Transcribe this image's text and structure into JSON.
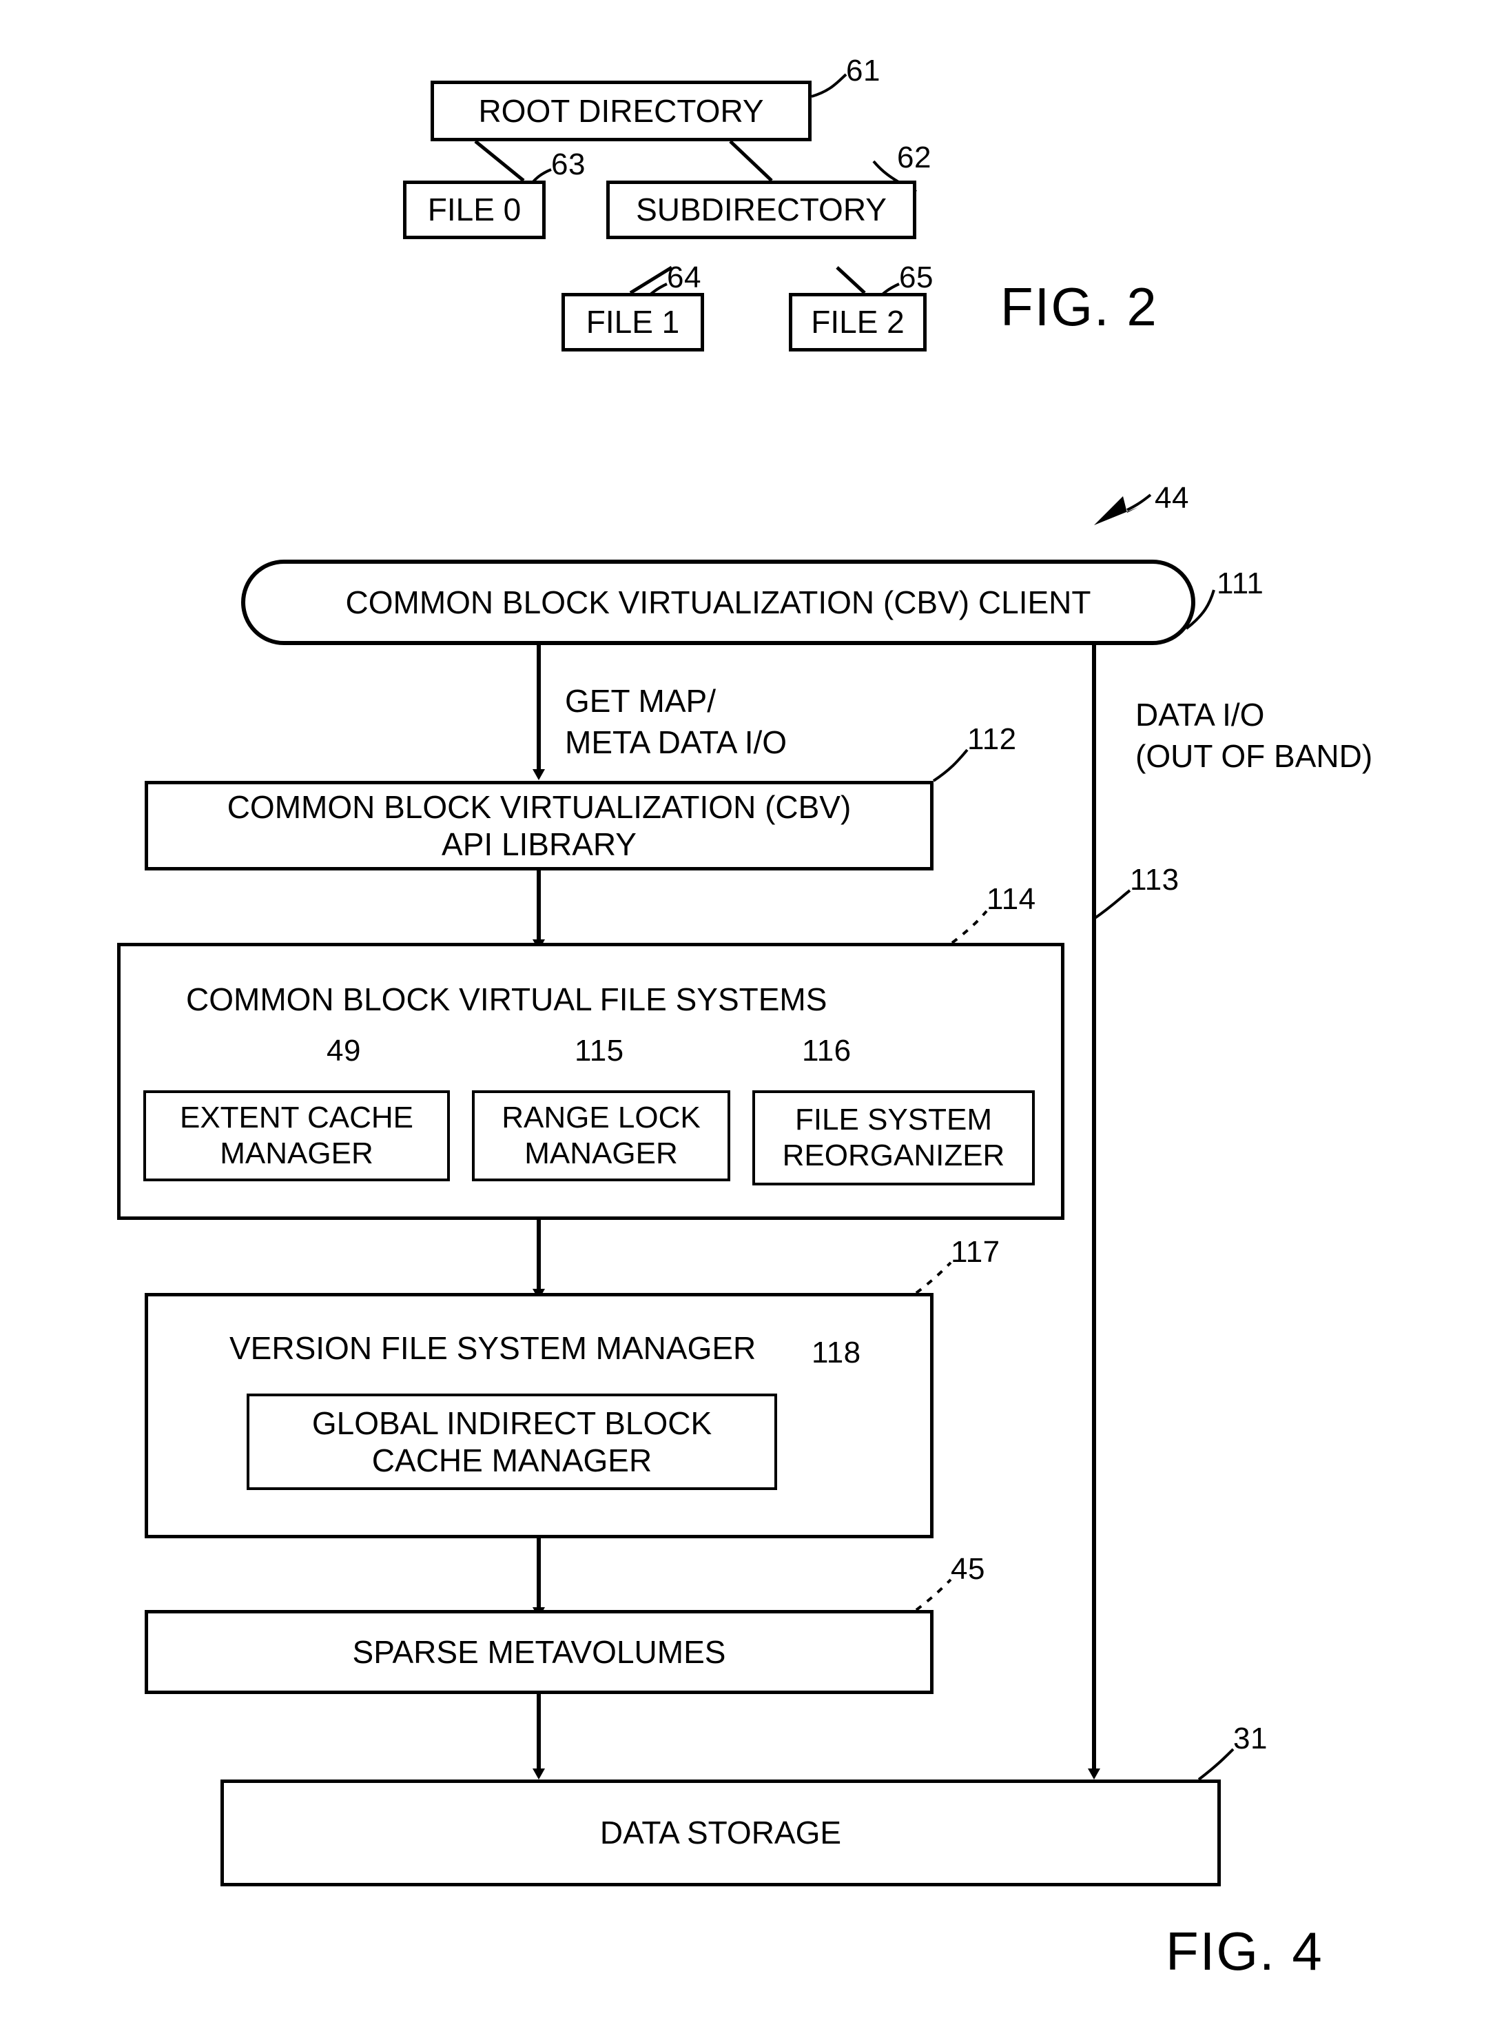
{
  "figure2": {
    "caption": "FIG. 2",
    "nodes": [
      {
        "id": "root",
        "label": "ROOT DIRECTORY",
        "ref": "61"
      },
      {
        "id": "file0",
        "label": "FILE 0",
        "ref": "63"
      },
      {
        "id": "subdir",
        "label": "SUBDIRECTORY",
        "ref": "62"
      },
      {
        "id": "file1",
        "label": "FILE 1",
        "ref": "64"
      },
      {
        "id": "file2",
        "label": "FILE 2",
        "ref": "65"
      }
    ]
  },
  "figure4": {
    "caption": "FIG. 4",
    "diagram_ref": "44",
    "nodes": {
      "cbv_client": {
        "label": "COMMON BLOCK VIRTUALIZATION (CBV) CLIENT",
        "ref": "111"
      },
      "cbv_api": {
        "line1": "COMMON BLOCK VIRTUALIZATION (CBV)",
        "line2": "API LIBRARY",
        "ref": "112"
      },
      "cbvfs": {
        "label": "COMMON BLOCK VIRTUAL  FILE SYSTEMS",
        "ref": "114"
      },
      "extent_cache": {
        "line1": "EXTENT CACHE",
        "line2": "MANAGER",
        "ref": "49"
      },
      "range_lock": {
        "line1": "RANGE LOCK",
        "line2": "MANAGER",
        "ref": "115"
      },
      "fs_reorg": {
        "line1": "FILE SYSTEM",
        "line2": "REORGANIZER",
        "ref": "116"
      },
      "vfsm": {
        "label": "VERSION FILE SYSTEM MANAGER",
        "ref": "117"
      },
      "gib_cache": {
        "line1": "GLOBAL INDIRECT BLOCK",
        "line2": "CACHE MANAGER",
        "ref": "118"
      },
      "sparse": {
        "label": "SPARSE METAVOLUMES",
        "ref": "45"
      },
      "storage": {
        "label": "DATA STORAGE",
        "ref": "31"
      }
    },
    "edges": {
      "get_map": {
        "line1": "GET MAP/",
        "line2": "META DATA I/O"
      },
      "data_io": {
        "line1": "DATA I/O",
        "line2": "(OUT OF BAND)",
        "ref": "113"
      }
    }
  }
}
